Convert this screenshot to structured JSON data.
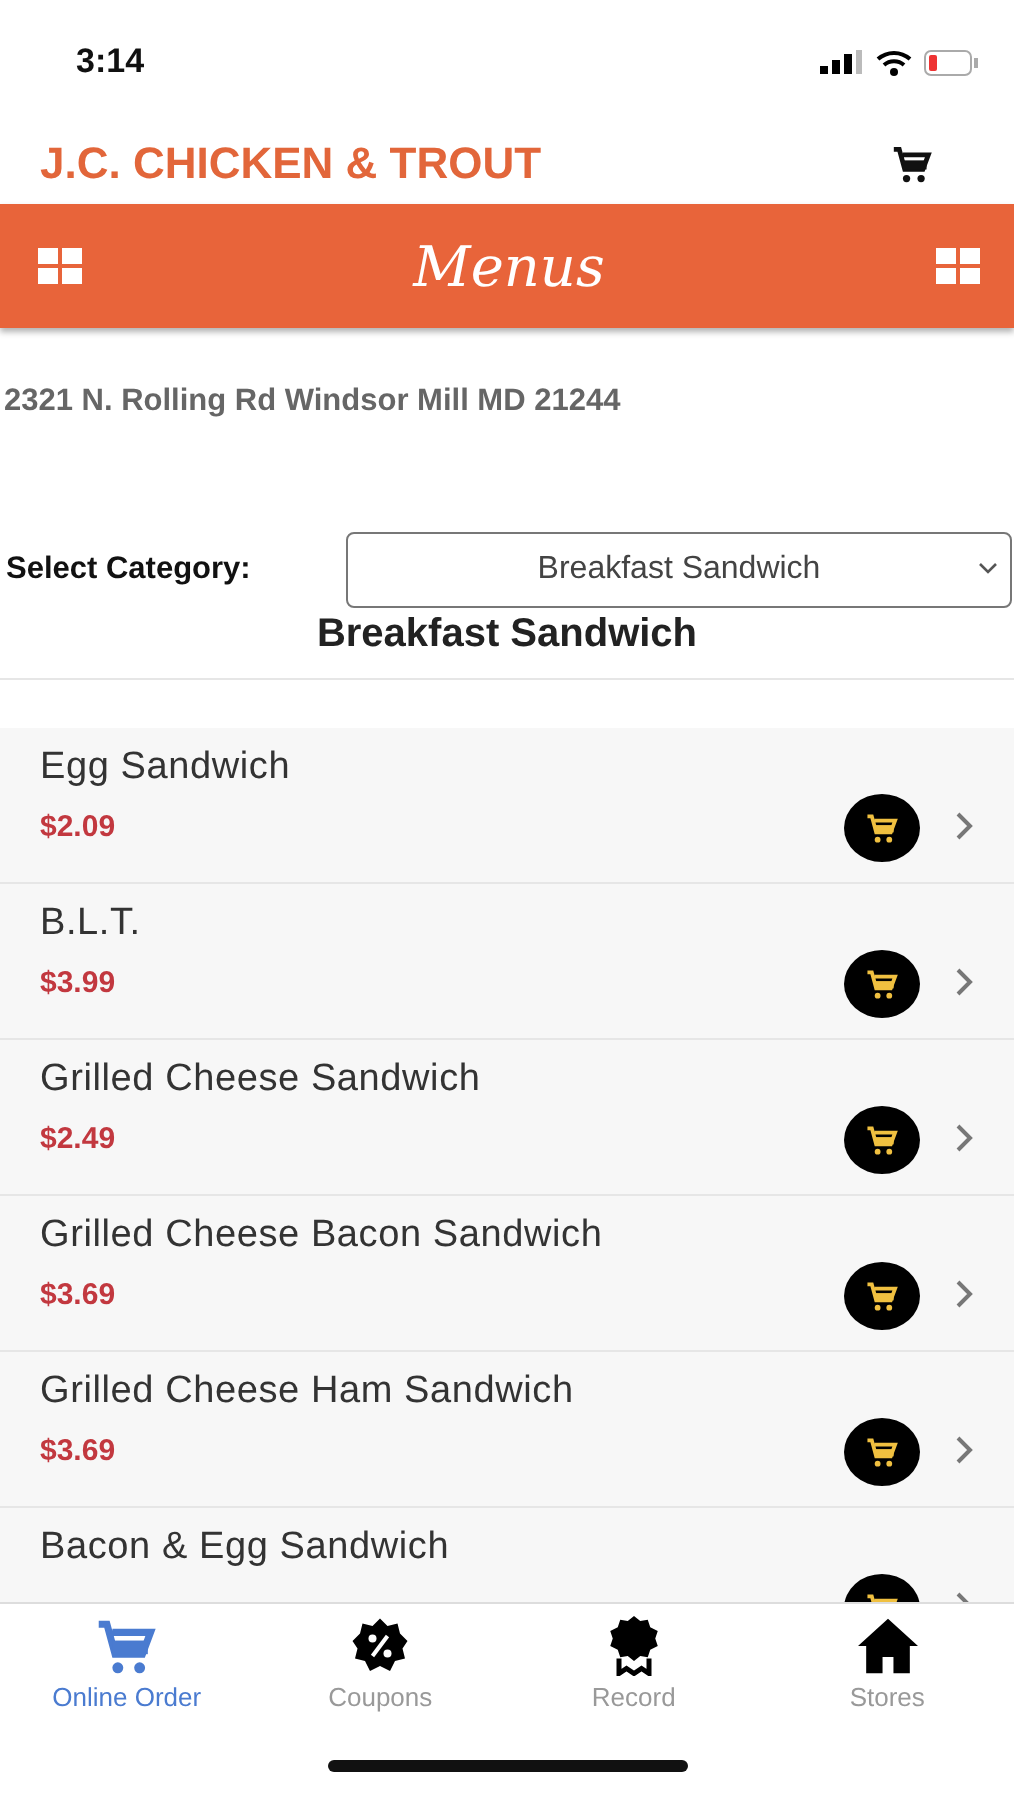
{
  "status_bar": {
    "time": "3:14"
  },
  "header": {
    "title": "J.C. CHICKEN & TROUT"
  },
  "menu_bar": {
    "title": "Menus"
  },
  "address": "2321 N. Rolling Rd Windsor Mill MD 21244",
  "category": {
    "label": "Select Category:",
    "value": "Breakfast Sandwich"
  },
  "section_title": "Breakfast Sandwich",
  "items": [
    {
      "name": "Egg Sandwich",
      "price": "$2.09"
    },
    {
      "name": "B.L.T.",
      "price": "$3.99"
    },
    {
      "name": "Grilled Cheese Sandwich",
      "price": "$2.49"
    },
    {
      "name": "Grilled Cheese Bacon Sandwich",
      "price": "$3.69"
    },
    {
      "name": "Grilled Cheese Ham Sandwich",
      "price": "$3.69"
    },
    {
      "name": "Bacon & Egg Sandwich"
    }
  ],
  "tabs": [
    {
      "label": "Online Order",
      "kind": "cart",
      "selected": true
    },
    {
      "label": "Coupons",
      "kind": "coupon",
      "selected": false
    },
    {
      "label": "Record",
      "kind": "award",
      "selected": false
    },
    {
      "label": "Stores",
      "kind": "home",
      "selected": false
    }
  ]
}
